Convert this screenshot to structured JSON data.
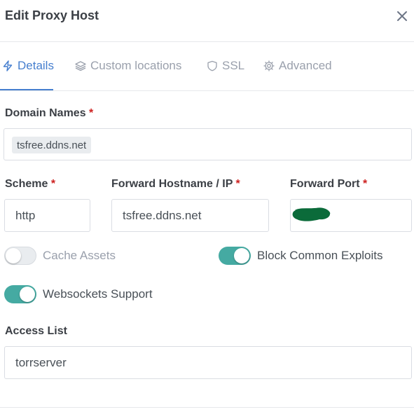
{
  "dialog": {
    "title": "Edit Proxy Host",
    "close_icon": "close-icon"
  },
  "tabs": [
    {
      "label": "Details",
      "icon": "bolt-icon",
      "active": true
    },
    {
      "label": "Custom locations",
      "icon": "layers-icon",
      "active": false
    },
    {
      "label": "SSL",
      "icon": "shield-icon",
      "active": false
    },
    {
      "label": "Advanced",
      "icon": "gear-icon",
      "active": false
    }
  ],
  "form": {
    "domain_names": {
      "label": "Domain Names",
      "required_mark": "*",
      "tags": [
        "tsfree.ddns.net"
      ]
    },
    "scheme": {
      "label": "Scheme",
      "required_mark": "*",
      "value": "http"
    },
    "forward_host": {
      "label": "Forward Hostname / IP",
      "required_mark": "*",
      "value": "tsfree.ddns.net"
    },
    "forward_port": {
      "label": "Forward Port",
      "required_mark": "*",
      "value": ""
    },
    "cache_assets": {
      "label": "Cache Assets",
      "enabled": false
    },
    "block_exploits": {
      "label": "Block Common Exploits",
      "enabled": true
    },
    "websockets": {
      "label": "Websockets Support",
      "enabled": true
    },
    "access_list": {
      "label": "Access List",
      "value": "torrserver"
    }
  },
  "colors": {
    "accent": "#467fcf",
    "toggle_on": "#45aaa2",
    "required": "#cd201f",
    "redaction": "#0b6b3a"
  }
}
